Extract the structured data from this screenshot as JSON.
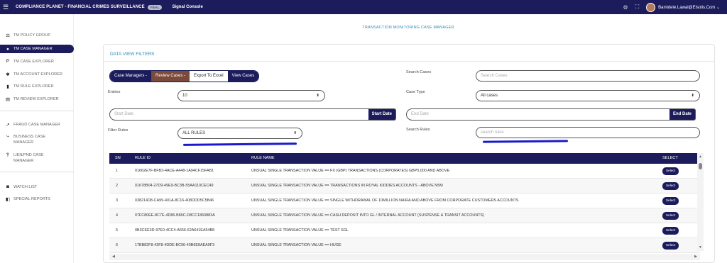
{
  "topbar": {
    "app_title": "COMPLIANCE PLANET - FINANCIAL CRIMES SURVEILLANCE",
    "badge": "FINAL",
    "console": "Signal Console",
    "user": "Bamidele.Lawal@Elsolis.Com",
    "user_caret": "⌄"
  },
  "sidebar": {
    "items": [
      {
        "label": "TM POLICY GROUP",
        "icon": "gavel-icon"
      },
      {
        "label": "TM CASE MANAGER",
        "icon": "folder-icon"
      },
      {
        "label": "TM CASE EXPLORER",
        "icon": "bitcoin-icon"
      },
      {
        "label": "TM ACCOUNT EXPLORER",
        "icon": "asterisk-icon"
      },
      {
        "label": "TM RULE EXPLORER",
        "icon": "file-icon"
      },
      {
        "label": "TM REVIEW EXPLORER",
        "icon": "id-card-icon"
      },
      {
        "label": "FRAUD CASE MANAGER",
        "icon": "trend-icon"
      },
      {
        "label": "BUSINESS CASE MANAGER",
        "icon": "branch-icon"
      },
      {
        "label": "LIEN/PND CASE MANAGER",
        "icon": "balance-icon"
      },
      {
        "label": "WATCH LIST",
        "icon": "eye-icon"
      },
      {
        "label": "SPECIAL REPORTS",
        "icon": "book-icon"
      }
    ]
  },
  "main": {
    "page_title": "TRANSACTION MONITORING CASE MANAGER",
    "panel_title": "DATA VIEW FILTERS",
    "buttons": {
      "case_managers": "Case Managers -",
      "review_cases": "Review Cases -",
      "export": "To Excel",
      "export_prefix": "Export",
      "view_cases": "View Cases"
    },
    "filters": {
      "entries_label": "Entries",
      "entries_value": "10",
      "search_cases_label": "Search Cases",
      "search_cases_placeholder": "Search Cases",
      "case_type_label": "Case Type",
      "case_type_value": "All cases",
      "start_date_placeholder": "Start Date",
      "start_date_button": "Start Date",
      "end_date_placeholder": "End Date",
      "end_date_button": "End Date",
      "filter_rules_label": "Filter Rules",
      "filter_rules_value": "ALL RULES",
      "search_rules_label": "Search Rules",
      "search_rules_placeholder": "search rules",
      "caret": "⬍"
    },
    "table": {
      "headers": {
        "sn": "SN",
        "rule_id": "RULE ID",
        "rule_name": "RULE NAME",
        "select": "SELECT"
      },
      "select_label": "Select",
      "rows": [
        {
          "sn": "1",
          "rule_id": "01662E7F-BFB3-4ACE-A448-1A94CF15FAB1",
          "rule_name": "UNSUAL SINGLE TRANSACTION VALUE  ==  FX (GBP) TRANSACTIONS (CORPORATES) GBP5,000 AND ABOVE"
        },
        {
          "sn": "2",
          "rule_id": "01678B04-27D9-49E9-BC3B-55AA110CEC49",
          "rule_name": "UNSUAL SINGLE TRANSACTION VALUE  ==  TRANSACTIONS IN ROYAL KIDDIES ACCOUNTS - ABOVE N5M"
        },
        {
          "sn": "3",
          "rule_id": "038214D8-CA99-401A-8C16-408DDD5C5B46",
          "rule_name": "UNSUAL SINGLE TRANSACTION VALUE  ==  SINGLE WITHDRAWAL OF 10MILLION NAIRA AND ABOVE FROM CORPORATE CUSTOMERS ACCOUNTS"
        },
        {
          "sn": "4",
          "rule_id": "07FC80EE-8C7E-4D86-B80C-D8CC1860883A",
          "rule_name": "UNSUAL SINGLE TRANSACTION VALUE  ==  CASH DEPOSIT INTO GL / INTERNAL ACCOUNT (SUSPENSE & TRANSIT ACCOUNTS)"
        },
        {
          "sn": "5",
          "rule_id": "0B3CEE3D-97E0-4CC4-A656-62A641EA54B8",
          "rule_name": "UNSUAL SINGLE TRANSACTION VALUE  ==  TEST SGL"
        },
        {
          "sn": "6",
          "rule_id": "17BB82F8-43F8-4DDE-BC96-40B6E8AEA9F3",
          "rule_name": "UNSUAL SINGLE TRANSACTION VALUE  ==  HUGE"
        }
      ]
    }
  },
  "colors": {
    "navy": "#1c1c5c",
    "brown": "#7a4a3a",
    "accent": "#2a8ab8",
    "annotation": "#1a1acc"
  }
}
